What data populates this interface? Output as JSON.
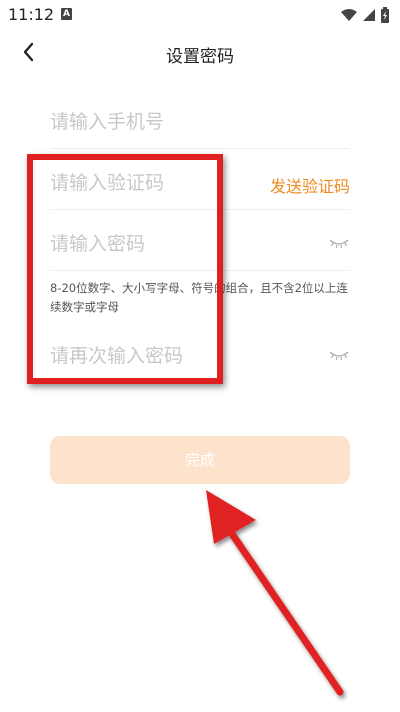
{
  "status_bar": {
    "time": "11:12",
    "notification_badge": "A"
  },
  "header": {
    "title": "设置密码"
  },
  "form": {
    "phone_placeholder": "请输入手机号",
    "code_placeholder": "请输入验证码",
    "send_code_label": "发送验证码",
    "password_placeholder": "请输入密码",
    "password_hint": "8-20位数字、大小写字母、符号的组合，且不含2位以上连续数字或字母",
    "confirm_placeholder": "请再次输入密码",
    "submit_label": "完成"
  },
  "colors": {
    "accent": "#ef8a1f",
    "button_disabled": "#fde3cc",
    "annotation_red": "#e02020"
  },
  "icons": [
    "back-arrow-icon",
    "eye-closed-icon",
    "wifi-icon",
    "signal-icon",
    "battery-icon"
  ]
}
